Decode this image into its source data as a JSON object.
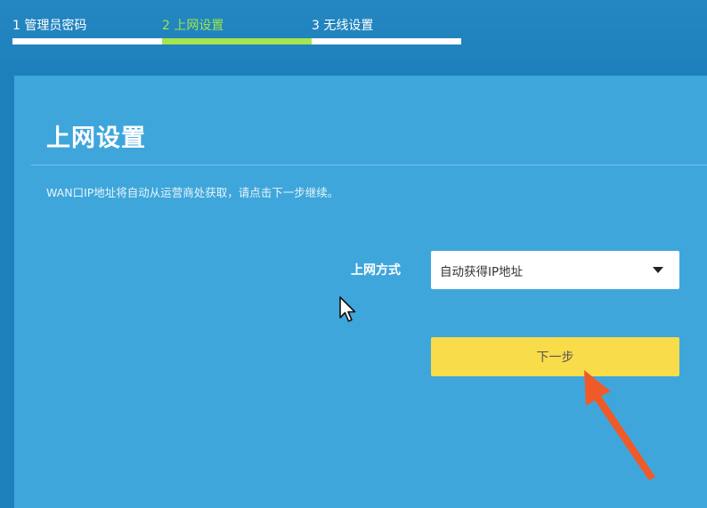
{
  "steps": [
    {
      "label": "1 管理员密码",
      "state": "done"
    },
    {
      "label": "2 上网设置",
      "state": "active"
    },
    {
      "label": "3 无线设置",
      "state": "pending"
    }
  ],
  "panel": {
    "title": "上网设置",
    "hint": "WAN口IP地址将自动从运营商处获取，请点击下一步继续。",
    "connection": {
      "label": "上网方式",
      "selected": "自动获得IP地址"
    },
    "next_button": "下一步"
  },
  "colors": {
    "background": "#1e80bb",
    "panel": "#3fa6db",
    "active_step": "#a6e54e",
    "button": "#f9dc4a",
    "annotation_arrow": "#f05a28"
  },
  "icons": {
    "cursor": "mouse-pointer-icon",
    "annotation": "pointing-arrow-icon",
    "dropdown": "caret-down-icon"
  }
}
